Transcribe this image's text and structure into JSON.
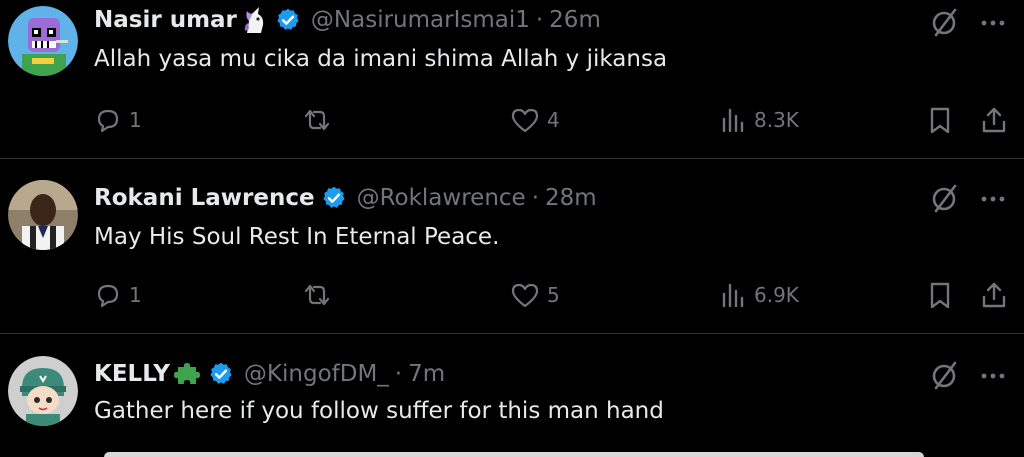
{
  "colors": {
    "background": "#000000",
    "text": "#e7e9ea",
    "muted": "#71767b",
    "divider": "#2f3336",
    "verified": "#1d9bf0"
  },
  "tweets": [
    {
      "name": "Nasir umar",
      "name_emoji": "unicorn-emoji",
      "handle": "@NasirumarIsmai1",
      "separator": "·",
      "time": "26m",
      "text": "Allah yasa mu cika da imani shima Allah y jikansa",
      "replies": "1",
      "reposts": "",
      "likes": "4",
      "views": "8.3K"
    },
    {
      "name": "Rokani Lawrence",
      "handle": "@Roklawrence",
      "separator": "·",
      "time": "28m",
      "text": "May His Soul Rest In Eternal Peace.",
      "replies": "1",
      "reposts": "",
      "likes": "5",
      "views": "6.9K"
    },
    {
      "name": "KELLY",
      "name_emoji": "puzzle-piece-emoji",
      "handle": "@KingofDM_",
      "separator": "·",
      "time": "7m",
      "text": "Gather here if you follow suffer for this man hand"
    }
  ]
}
